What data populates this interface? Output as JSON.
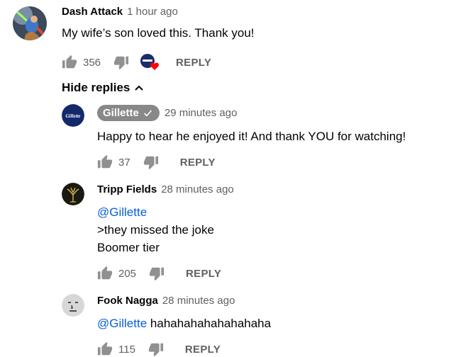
{
  "comment": {
    "author": "Dash Attack",
    "time": "1 hour ago",
    "text": "My wife’s son loved this. Thank you!",
    "likes": "356",
    "reply_label": "REPLY",
    "hearted_by_creator": true
  },
  "hide_replies_label": "Hide replies",
  "replies": [
    {
      "author": "Gillette",
      "verified": true,
      "time": "29 minutes ago",
      "text": "Happy to hear he enjoyed it! And thank YOU for watching!",
      "likes": "37",
      "reply_label": "REPLY",
      "avatar_text": "Gillette"
    },
    {
      "author": "Tripp Fields",
      "time": "28 minutes ago",
      "mention": "@Gillette",
      "line2": ">they missed the joke",
      "line3": "Boomer tier",
      "likes": "205",
      "reply_label": "REPLY"
    },
    {
      "author": "Fook Nagga",
      "time": "28 minutes ago",
      "mention": "@Gillette",
      "text": "hahahahahahahahaha",
      "likes": "115",
      "reply_label": "REPLY"
    }
  ],
  "colors": {
    "link": "#065fd4",
    "secondary_text": "#606060",
    "verified_badge_bg": "#888888",
    "heart": "#ff0000"
  }
}
